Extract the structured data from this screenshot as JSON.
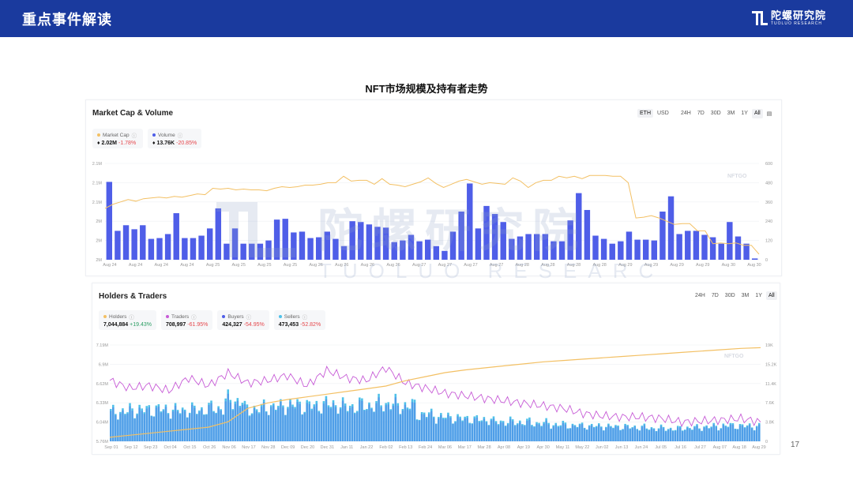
{
  "banner": {
    "title": "重点事件解读"
  },
  "logo": {
    "cn": "陀螺研究院",
    "en": "TUOLUO RESEARCH"
  },
  "page_title": "NFT市场规模及持有者走势",
  "page_number": "17",
  "colors": {
    "banner": "#1a3a9e",
    "market_cap": "#f3c064",
    "volume": "#4f5ee8",
    "holders": "#f3c064",
    "traders": "#c75bd6",
    "buyers": "#4f5ee8",
    "sellers": "#4fc1e9"
  },
  "panel1": {
    "title": "Market Cap & Volume",
    "currency_tabs": [
      "ETH",
      "USD"
    ],
    "range_tabs": [
      "24H",
      "7D",
      "30D",
      "3M",
      "1Y",
      "All"
    ],
    "legend": [
      {
        "name": "Market Cap",
        "value": "2.02M",
        "change": "-1.78%"
      },
      {
        "name": "Volume",
        "value": "13.76K",
        "change": "-20.85%"
      }
    ],
    "watermark": "NFTGO"
  },
  "panel2": {
    "title": "Holders & Traders",
    "range_tabs": [
      "24H",
      "7D",
      "30D",
      "3M",
      "1Y",
      "All"
    ],
    "legend": [
      {
        "name": "Holders",
        "value": "7,044,884",
        "change": "+19.43%"
      },
      {
        "name": "Traders",
        "value": "708,997",
        "change": "-61.95%"
      },
      {
        "name": "Buyers",
        "value": "424,327",
        "change": "-54.95%"
      },
      {
        "name": "Sellers",
        "value": "473,453",
        "change": "-52.82%"
      }
    ],
    "watermark": "NFTGO"
  },
  "watermark": {
    "cn": "陀螺研究院",
    "en": "TUOLUO RESEARCH"
  },
  "chart_data": [
    {
      "type": "bar",
      "title": "Market Cap & Volume",
      "x_tick_labels": [
        "Aug 24",
        "Aug 24",
        "Aug 24",
        "Aug 24",
        "Aug 25",
        "Aug 25",
        "Aug 25",
        "Aug 25",
        "Aug 26",
        "Aug 26",
        "Aug 26",
        "Aug 26",
        "Aug 27",
        "Aug 27",
        "Aug 27",
        "Aug 27",
        "Aug 28",
        "Aug 28",
        "Aug 28",
        "Aug 28",
        "Aug 29",
        "Aug 29",
        "Aug 29",
        "Aug 29",
        "Aug 30",
        "Aug 30"
      ],
      "y_left_ticks": [
        "2M",
        "2M",
        "2M",
        "2.1M",
        "2.1M",
        "2.1M"
      ],
      "y_right_ticks": [
        "0",
        "120",
        "240",
        "360",
        "480",
        "600"
      ],
      "y_right_lim": [
        0,
        600
      ],
      "y_left_lim": [
        0,
        600
      ],
      "series": [
        {
          "name": "Volume",
          "kind": "bar",
          "axis": "right",
          "values": [
            485,
            180,
            215,
            190,
            215,
            130,
            135,
            160,
            290,
            135,
            135,
            150,
            195,
            320,
            100,
            195,
            100,
            100,
            100,
            120,
            250,
            255,
            170,
            175,
            135,
            140,
            175,
            130,
            85,
            240,
            235,
            220,
            205,
            200,
            110,
            120,
            155,
            115,
            125,
            85,
            55,
            175,
            300,
            475,
            195,
            335,
            285,
            235,
            130,
            145,
            160,
            160,
            160,
            115,
            115,
            245,
            415,
            310,
            150,
            130,
            100,
            115,
            175,
            125,
            125,
            120,
            300,
            395,
            160,
            180,
            180,
            155,
            140,
            100,
            235,
            145,
            100,
            8
          ]
        },
        {
          "name": "Market Cap",
          "kind": "line",
          "axis": "right",
          "values": [
            320,
            345,
            360,
            375,
            365,
            380,
            385,
            390,
            385,
            395,
            390,
            400,
            410,
            405,
            445,
            440,
            445,
            435,
            440,
            435,
            435,
            430,
            445,
            455,
            450,
            455,
            465,
            465,
            470,
            480,
            480,
            520,
            490,
            495,
            495,
            470,
            505,
            470,
            465,
            455,
            470,
            485,
            510,
            475,
            450,
            470,
            490,
            500,
            485,
            470,
            480,
            475,
            470,
            510,
            490,
            450,
            480,
            495,
            495,
            520,
            510,
            520,
            505,
            525,
            525,
            525,
            520,
            520,
            480,
            260,
            265,
            275,
            260,
            240,
            220,
            225,
            225,
            180,
            180,
            100,
            105,
            100,
            105,
            90,
            90,
            35
          ]
        }
      ]
    },
    {
      "type": "bar",
      "title": "Holders & Traders",
      "x_tick_labels": [
        "Sep 01",
        "Sep 12",
        "Sep 23",
        "Oct 04",
        "Oct 15",
        "Oct 26",
        "Nov 06",
        "Nov 17",
        "Nov 28",
        "Dec 09",
        "Dec 20",
        "Dec 31",
        "Jan 11",
        "Jan 22",
        "Feb 02",
        "Feb 13",
        "Feb 24",
        "Mar 06",
        "Mar 17",
        "Mar 28",
        "Apr 08",
        "Apr 19",
        "Apr 30",
        "May 11",
        "May 22",
        "Jun 02",
        "Jun 13",
        "Jun 24",
        "Jul 05",
        "Jul 16",
        "Jul 27",
        "Aug 07",
        "Aug 18",
        "Aug 29"
      ],
      "y_left_ticks": [
        "5.76M",
        "6.04M",
        "6.33M",
        "6.62M",
        "6.9M",
        "7.19M"
      ],
      "y_right_ticks": [
        "0",
        "3.8K",
        "7.6K",
        "11.4K",
        "15.2K",
        "19K"
      ],
      "y_left_lim": [
        5.76,
        7.19
      ],
      "y_right_lim": [
        0,
        19
      ],
      "series": [
        {
          "name": "Holders",
          "kind": "line",
          "axis": "left",
          "unit": "M",
          "values": [
            5.82,
            5.85,
            5.88,
            5.91,
            5.94,
            5.97,
            6.05,
            6.25,
            6.33,
            6.38,
            6.42,
            6.46,
            6.5,
            6.54,
            6.58,
            6.66,
            6.72,
            6.78,
            6.82,
            6.85,
            6.88,
            6.91,
            6.94,
            6.96,
            6.98,
            7.0,
            7.02,
            7.04,
            7.06,
            7.08,
            7.1,
            7.12,
            7.14,
            7.15
          ]
        },
        {
          "name": "Traders",
          "kind": "line",
          "axis": "right",
          "unit": "K",
          "values": [
            12.0,
            10.5,
            11.0,
            10.0,
            12.5,
            11.0,
            13.5,
            11.5,
            12.0,
            13.0,
            11.0,
            14.0,
            12.5,
            12.0,
            14.5,
            11.5,
            10.5,
            9.5,
            9.0,
            8.5,
            8.0,
            7.5,
            7.0,
            6.5,
            5.5,
            5.0,
            4.8,
            4.8,
            4.5,
            3.8,
            4.0,
            4.2,
            4.5,
            3.8
          ]
        },
        {
          "name": "Buyers",
          "kind": "bar",
          "axis": "right",
          "unit": "K",
          "values": [
            5.5,
            5.8,
            6.0,
            5.8,
            5.9,
            6.2,
            7.5,
            6.0,
            6.5,
            6.8,
            6.6,
            6.9,
            6.5,
            6.8,
            7.0,
            6.6,
            5.0,
            4.5,
            4.2,
            4.0,
            3.6,
            3.5,
            3.3,
            3.0,
            2.9,
            2.8,
            2.7,
            2.6,
            2.4,
            2.3,
            2.5,
            2.7,
            2.9,
            2.8
          ]
        },
        {
          "name": "Sellers",
          "kind": "bar",
          "axis": "right",
          "unit": "K",
          "values": [
            5.8,
            6.2,
            6.3,
            6.1,
            6.2,
            6.5,
            8.0,
            6.4,
            6.8,
            7.2,
            7.0,
            7.3,
            6.9,
            7.1,
            7.4,
            7.0,
            5.3,
            4.8,
            4.5,
            4.3,
            3.9,
            3.8,
            3.6,
            3.3,
            3.1,
            3.0,
            2.9,
            2.8,
            2.6,
            2.5,
            2.7,
            2.9,
            3.1,
            3.0
          ]
        }
      ]
    }
  ]
}
